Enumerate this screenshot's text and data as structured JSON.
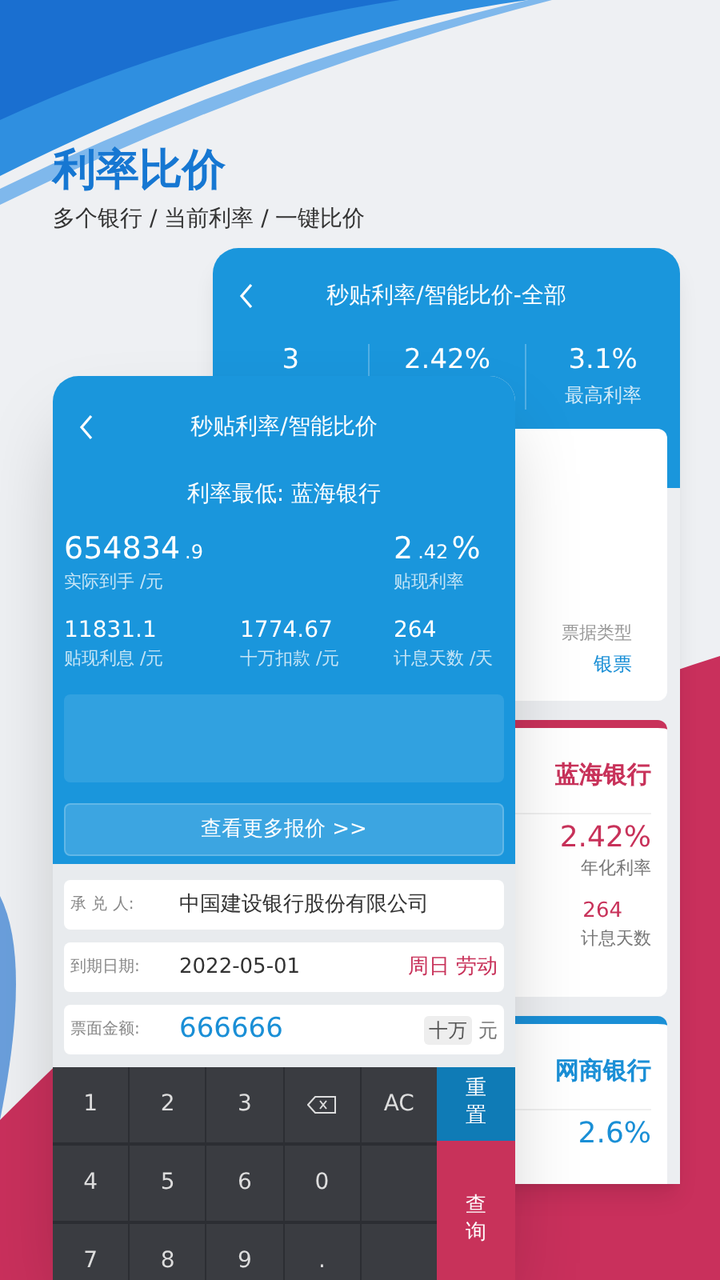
{
  "banner": {
    "title": "利率比价",
    "subtitle": "多个银行 / 当前利率 / 一键比价"
  },
  "back_screen": {
    "title": "秒贴利率/智能比价-全部",
    "stats": [
      {
        "value": "3"
      },
      {
        "value": "2.42%"
      },
      {
        "value": "3.1%",
        "label": "最高利率"
      }
    ],
    "cards": [
      {
        "kind": "type",
        "label": "票据类型",
        "value": "银票"
      },
      {
        "kind": "bank",
        "color": "#c8325a",
        "bank": "蓝海银行",
        "rate": "2.42%",
        "rate_label": "年化利率",
        "days": "264",
        "days_label": "计息天数"
      },
      {
        "kind": "bank",
        "color": "#1a8fd6",
        "bank": "网商银行",
        "rate": "2.6%"
      }
    ]
  },
  "front_screen": {
    "title": "秒贴利率/智能比价",
    "best": "利率最低: 蓝海银行",
    "stats": [
      {
        "value": "654834",
        "small": ".9",
        "label": "实际到手 /元"
      },
      {
        "value": "2",
        "small": ".42",
        "suffix": "%",
        "label": "贴现利率"
      },
      {
        "value": "11831.1",
        "label": "贴现利息 /元"
      },
      {
        "value": "1774.67",
        "label": "十万扣款 /元"
      },
      {
        "value": "264",
        "label": "计息天数 /天"
      }
    ],
    "more_button": "查看更多报价 >>",
    "form": [
      {
        "kind": "text",
        "label": "承 兑 人:",
        "value": "中国建设银行股份有限公司"
      },
      {
        "kind": "date",
        "label": "到期日期:",
        "value": "2022-05-01",
        "note": "周日 劳动"
      },
      {
        "kind": "amount",
        "label": "票面金额:",
        "value": "666666",
        "unit_button": "十万",
        "unit": "元"
      }
    ],
    "keys": [
      {
        "kind": "digit",
        "label": "1"
      },
      {
        "kind": "digit",
        "label": "2"
      },
      {
        "kind": "digit",
        "label": "3"
      },
      {
        "kind": "backspace"
      },
      {
        "kind": "digit",
        "label": "AC"
      },
      {
        "kind": "digit",
        "label": "4"
      },
      {
        "kind": "digit",
        "label": "5"
      },
      {
        "kind": "digit",
        "label": "6"
      },
      {
        "kind": "digit",
        "label": "0"
      },
      {
        "kind": "blank"
      },
      {
        "kind": "digit",
        "label": "7"
      },
      {
        "kind": "digit",
        "label": "8"
      },
      {
        "kind": "digit",
        "label": "9"
      },
      {
        "kind": "digit",
        "label": "."
      },
      {
        "kind": "blank"
      }
    ],
    "side_buttons": [
      {
        "kind": "reset",
        "label": "重置"
      },
      {
        "kind": "query",
        "label": "查询"
      }
    ]
  }
}
